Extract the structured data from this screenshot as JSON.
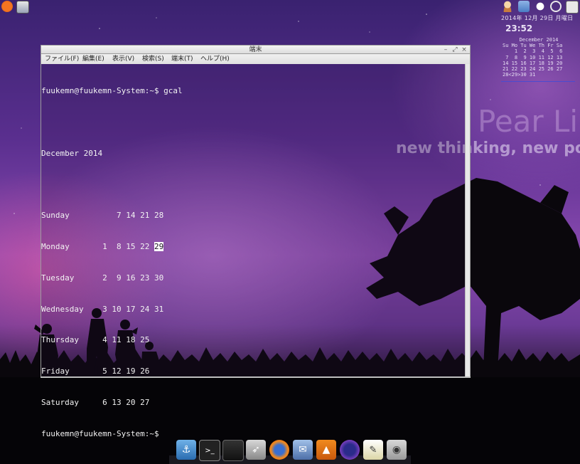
{
  "panel": {
    "date": "2014年 12月 29日 月曜日",
    "time": "23:52"
  },
  "calendar_widget": {
    "title": "December 2014",
    "header": "Su Mo Tu We Th Fr Sa",
    "rows": [
      "    1  2  3  4  5  6",
      " 7  8  9 10 11 12 13",
      "14 15 16 17 18 19 20",
      "21 22 23 24 25 26 27",
      "28<29>30 31"
    ]
  },
  "wallpaper": {
    "brand": "Pear Lin",
    "tagline": "new thinking, new pos"
  },
  "terminal": {
    "title": "端末",
    "menu": [
      "ファイル(F)",
      "編集(E)",
      "表示(V)",
      "検索(S)",
      "端末(T)",
      "ヘルプ(H)"
    ],
    "prompt_cmd": "fuukemn@fuukemn-System:~$ gcal",
    "month_title": "December 2014",
    "days": [
      {
        "name": "Sunday   ",
        "nums": "       7 14 21 28",
        "hl": ""
      },
      {
        "name": "Monday   ",
        "nums": "    1  8 15 22 ",
        "hl": "29"
      },
      {
        "name": "Tuesday  ",
        "nums": "    2  9 16 23 30",
        "hl": ""
      },
      {
        "name": "Wednesday",
        "nums": "    3 10 17 24 31",
        "hl": ""
      },
      {
        "name": "Thursday ",
        "nums": "    4 11 18 25",
        "hl": ""
      },
      {
        "name": "Friday   ",
        "nums": "    5 12 19 26",
        "hl": ""
      },
      {
        "name": "Saturday ",
        "nums": "    6 13 20 27",
        "hl": ""
      }
    ],
    "prompt_end": "fuukemn@fuukemn-System:~$"
  },
  "dock": {
    "icons": [
      "anchor-icon",
      "terminal-icon",
      "monitor-icon",
      "rocket-icon",
      "firefox-icon",
      "mail-icon",
      "vlc-icon",
      "eclipse-icon",
      "text-editor-icon",
      "camera-icon"
    ]
  },
  "colors": {
    "terminal_text": "#f2f2f2",
    "calendar_underline": "#4b4bd0"
  }
}
